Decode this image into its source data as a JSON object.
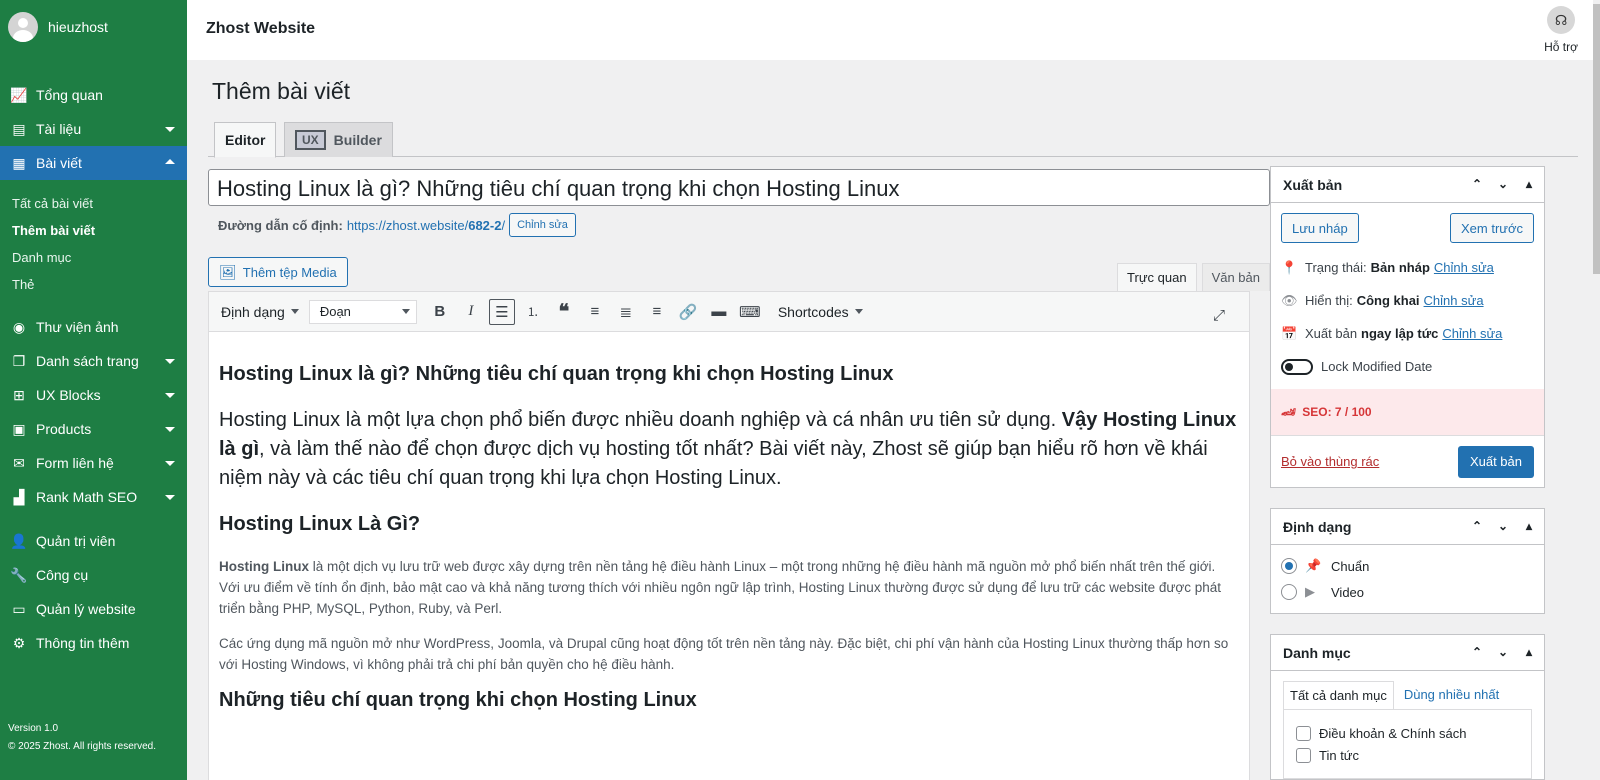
{
  "user": {
    "name": "hieuzhost"
  },
  "sidebar": {
    "items": [
      {
        "label": "Tổng quan",
        "icon": "chart-icon"
      },
      {
        "label": "Tài liệu",
        "icon": "doc-icon"
      },
      {
        "label": "Bài viết",
        "icon": "posts-icon"
      },
      {
        "label": "Thư viện ảnh",
        "icon": "media-icon"
      },
      {
        "label": "Danh sách trang",
        "icon": "pages-icon"
      },
      {
        "label": "UX Blocks",
        "icon": "blocks-icon"
      },
      {
        "label": "Products",
        "icon": "products-icon"
      },
      {
        "label": "Form liên hệ",
        "icon": "mail-icon"
      },
      {
        "label": "Rank Math SEO",
        "icon": "seo-icon"
      },
      {
        "label": "Quản trị viên",
        "icon": "user-icon"
      },
      {
        "label": "Công cụ",
        "icon": "wrench-icon"
      },
      {
        "label": "Quản lý website",
        "icon": "monitor-icon"
      },
      {
        "label": "Thông tin thêm",
        "icon": "gear-icon"
      }
    ],
    "submenu": [
      "Tất cả bài viết",
      "Thêm bài viết",
      "Danh mục",
      "Thẻ"
    ],
    "version": "Version 1.0",
    "copyright": "© 2025 Zhost. All rights reserved."
  },
  "topbar": {
    "site_title": "Zhost Website",
    "help_label": "Hỗ trợ"
  },
  "page": {
    "title": "Thêm bài viết"
  },
  "mode_tabs": {
    "editor": "Editor",
    "ux": "UX",
    "builder": "Builder"
  },
  "post": {
    "title": "Hosting Linux là gì? Những tiêu chí quan trọng khi chọn Hosting Linux",
    "permalink_label": "Đường dẫn cố định:",
    "permalink_base": "https://zhost.website/",
    "permalink_slug": "682-2",
    "permalink_end": "/",
    "edit_label": "Chỉnh sửa"
  },
  "editor": {
    "add_media": "Thêm tệp Media",
    "tab_visual": "Trực quan",
    "tab_text": "Văn bản",
    "format_label": "Định dạng",
    "paragraph_select": "Đoạn",
    "shortcodes": "Shortcodes"
  },
  "content": {
    "h1": "Hosting Linux là gì? Những tiêu chí quan trọng khi chọn Hosting Linux",
    "intro_a": "Hosting Linux là một lựa chọn phổ biến được nhiều doanh nghiệp và cá nhân ưu tiên sử dụng. ",
    "intro_b": "Vậy Hosting Linux là gì",
    "intro_c": ", và làm thế nào để chọn được dịch vụ hosting tốt nhất? Bài viết này, Zhost sẽ giúp bạn hiểu rõ hơn về khái niệm này và các tiêu chí quan trọng khi lựa chọn Hosting Linux.",
    "h2": "Hosting Linux Là Gì?",
    "p1_bold": "Hosting Linux",
    "p1": " là một dịch vụ lưu trữ web được xây dựng trên nền tảng hệ điều hành Linux – một trong những hệ điều hành mã nguồn mở phổ biến nhất trên thế giới. Với ưu điểm về tính ổn định, bảo mật cao và khả năng tương thích với nhiều ngôn ngữ lập trình, Hosting Linux thường được sử dụng để lưu trữ các website được phát triển bằng PHP, MySQL, Python, Ruby, và Perl.",
    "p2": "Các ứng dụng mã nguồn mở như WordPress, Joomla, và Drupal cũng hoạt động tốt trên nền tảng này. Đặc biệt, chi phí vận hành của Hosting Linux thường thấp hơn so với Hosting Windows, vì không phải trả chi phí bản quyền cho hệ điều hành.",
    "h3": "Những tiêu chí quan trọng khi chọn Hosting Linux"
  },
  "publish": {
    "title": "Xuất bản",
    "save_draft": "Lưu nháp",
    "preview": "Xem trước",
    "status_label": "Trạng thái:",
    "status_value": "Bản nháp",
    "visibility_label": "Hiển thị:",
    "visibility_value": "Công khai",
    "publish_label": "Xuất bản",
    "publish_value": "ngay lập tức",
    "edit": "Chỉnh sửa",
    "lock_modified": "Lock Modified Date",
    "seo": "SEO: 7 / 100",
    "trash": "Bỏ vào thùng rác",
    "publish_btn": "Xuất bản"
  },
  "format_box": {
    "title": "Định dạng",
    "options": [
      "Chuẩn",
      "Video"
    ],
    "selected": "Chuẩn"
  },
  "category_box": {
    "title": "Danh mục",
    "tab_all": "Tất cả danh mục",
    "tab_popular": "Dùng nhiều nhất",
    "categories": [
      "Điều khoản & Chính sách",
      "Tin tức"
    ]
  }
}
